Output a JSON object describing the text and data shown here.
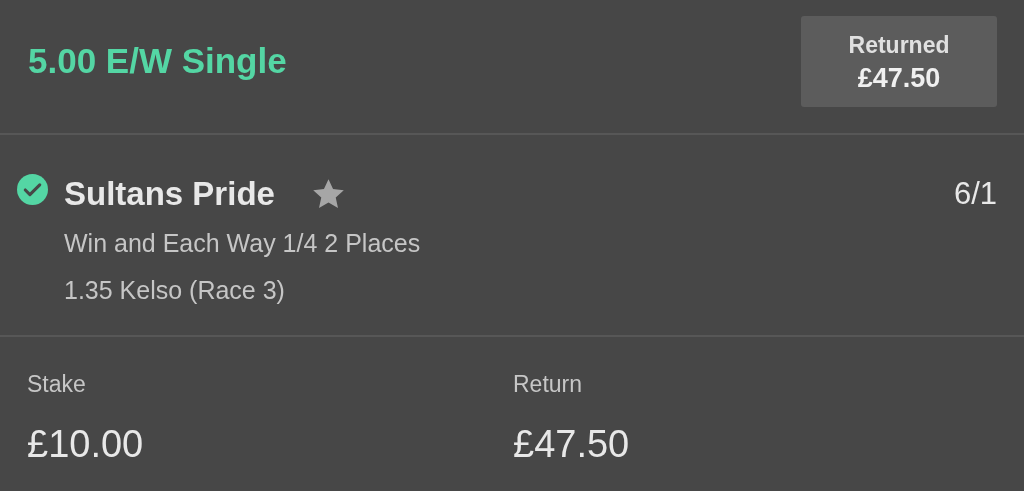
{
  "bet": {
    "title": "5.00 E/W Single",
    "status_label": "Returned",
    "status_amount": "£47.50"
  },
  "selection": {
    "name": "Sultans Pride",
    "odds": "6/1",
    "market": "Win and Each Way 1/4 2 Places",
    "event": "1.35 Kelso (Race 3)"
  },
  "totals": [
    {
      "label": "Stake",
      "value": "£10.00"
    },
    {
      "label": "Return",
      "value": "£47.50"
    }
  ]
}
